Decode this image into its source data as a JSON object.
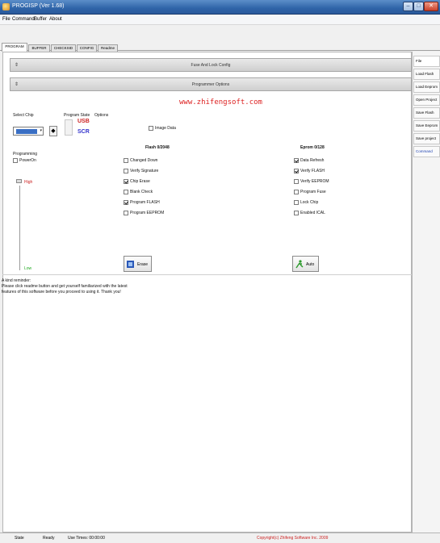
{
  "window": {
    "title": "PROGISP (Ver 1.68)"
  },
  "menu": [
    "File",
    "Command",
    "Buffer",
    "About"
  ],
  "tabs": [
    "PROGRAM",
    "BUFFER",
    "CHECKSID",
    "CONFIG",
    "Readme"
  ],
  "bands": {
    "fuse": "Fuse And Lock Config",
    "programmer": "Programmer Options"
  },
  "watermark": "www.zhifengsoft.com",
  "select_chip": {
    "label": "Select Chip",
    "value": "ATmega8A"
  },
  "program_state": {
    "label": "Program State",
    "usb": "USB",
    "scr": "SCR"
  },
  "options_label": "Options",
  "image_data": {
    "label": "Image Data",
    "checked": false
  },
  "programming": {
    "label": "Programming",
    "power_on": "PowerOn",
    "high": "High",
    "low": "Low"
  },
  "flash": {
    "title": "Flash 0/2048"
  },
  "eprom": {
    "title": "Eprom 0/128"
  },
  "flash_ops": [
    {
      "label": "Changed Down",
      "checked": false
    },
    {
      "label": "Verify Signature",
      "checked": false
    },
    {
      "label": "Chip Erase",
      "checked": true
    },
    {
      "label": "Blank Check",
      "checked": false
    },
    {
      "label": "Program FLASH",
      "checked": true
    },
    {
      "label": "Program EEPROM",
      "checked": false
    }
  ],
  "eprom_ops": [
    {
      "label": "Data Refresh",
      "checked": true
    },
    {
      "label": "Verify FLASH",
      "checked": true
    },
    {
      "label": "Verify EEPROM",
      "checked": false
    },
    {
      "label": "Program Fuse",
      "checked": false
    },
    {
      "label": "Lock Chip",
      "checked": false
    },
    {
      "label": "Enabled ICAL",
      "checked": false
    }
  ],
  "buttons": {
    "erase": "Erase",
    "auto": "Auto"
  },
  "tip": "A kind reminder:\nPlease click readme button and get yourself familiarized with the latest features of this software before you proceed to using it. Thank you!",
  "sidebar": [
    "File",
    "Load Flash",
    "Load Eeprom",
    "Open Project",
    "Save Flash",
    "Save Eeprom",
    "Save project",
    "Command"
  ],
  "status": {
    "state_label": "State",
    "state_value": "Ready",
    "use_time": "Use Times: 00:00:00",
    "copyright": "Copyright(c) Zhifeng Software Inc. 2009"
  }
}
